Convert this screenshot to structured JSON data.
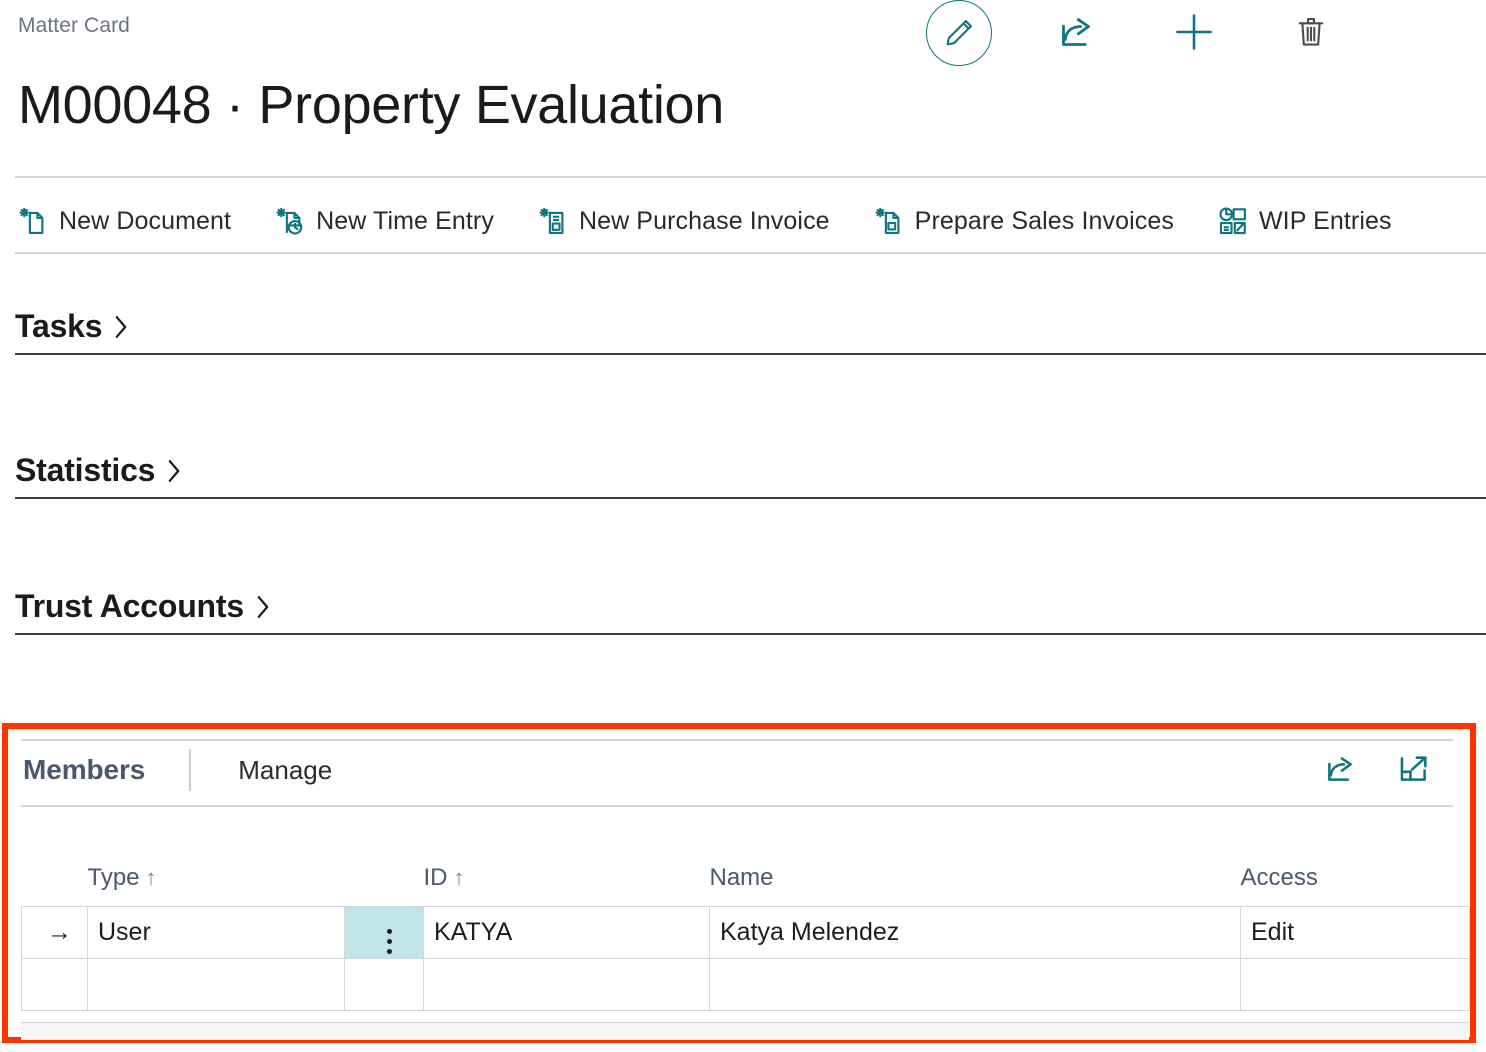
{
  "header": {
    "breadcrumb": "Matter Card",
    "title": "M00048 · Property Evaluation",
    "actions": [
      {
        "name": "edit-button",
        "icon": "pencil-icon",
        "label": "Edit"
      },
      {
        "name": "share-button",
        "icon": "share-icon",
        "label": "Share"
      },
      {
        "name": "new-button",
        "icon": "plus-icon",
        "label": "New"
      },
      {
        "name": "delete-button",
        "icon": "trash-icon",
        "label": "Delete"
      }
    ]
  },
  "action_bar": {
    "items": [
      {
        "label": "New Document",
        "icon": "new-document-icon"
      },
      {
        "label": "New Time Entry",
        "icon": "new-time-entry-icon"
      },
      {
        "label": "New Purchase Invoice",
        "icon": "new-purchase-invoice-icon"
      },
      {
        "label": "Prepare Sales Invoices",
        "icon": "prepare-sales-invoices-icon"
      },
      {
        "label": "WIP Entries",
        "icon": "wip-entries-icon"
      }
    ]
  },
  "sections": [
    {
      "title": "Tasks",
      "expanded": false,
      "chevron": "chevron-right-icon"
    },
    {
      "title": "Statistics",
      "expanded": false,
      "chevron": "chevron-right-icon"
    },
    {
      "title": "Trust Accounts",
      "expanded": false,
      "chevron": "chevron-right-icon"
    }
  ],
  "members": {
    "caption": "Members",
    "manage_label": "Manage",
    "icons": [
      {
        "name": "share-icon",
        "label": "Share"
      },
      {
        "name": "expand-icon",
        "label": "Open in full screen"
      }
    ],
    "grid": {
      "columns": [
        {
          "label": "Type",
          "sort": "ascending"
        },
        {
          "label": "ID",
          "sort": "ascending"
        },
        {
          "label": "Name",
          "sort": ""
        },
        {
          "label": "Access",
          "sort": ""
        }
      ],
      "sort_glyph": "↑",
      "row_indicator": "→",
      "rows": [
        {
          "indicator": "→",
          "selected_cell": "kebab",
          "type": "User",
          "id": "KATYA",
          "name": "Katya Melendez",
          "access": "Edit"
        },
        {
          "indicator": "",
          "selected_cell": "",
          "type": "",
          "id": "",
          "name": "",
          "access": ""
        }
      ]
    }
  },
  "colors": {
    "accent_teal": "#0d7680",
    "highlight_red": "#ff3300",
    "selected_cell": "#bfe4ea",
    "caption_slate": "#4c586b"
  }
}
